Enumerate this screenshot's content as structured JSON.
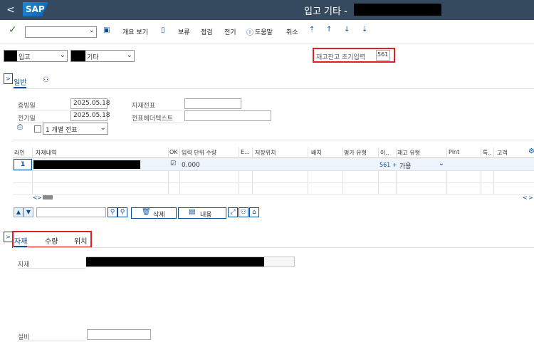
{
  "titlebar": {
    "back": "<",
    "logo": "SAP",
    "title": "입고 기타 -"
  },
  "toolbar": {
    "check": "✓",
    "overview": "개요 보기",
    "hold": "보류",
    "check_btn": "점검",
    "post": "전기",
    "help": "도움말",
    "cancel": "취소"
  },
  "header": {
    "movement_left": "입고",
    "movement_right": "기타",
    "stock_init_label": "재고잔고 초기입력",
    "stock_init_value": "561"
  },
  "tabs_top": {
    "general": "일반"
  },
  "general": {
    "doc_date_label": "증빙일",
    "doc_date": "2025.05.18",
    "post_date_label": "전기일",
    "post_date": "2025.05.18",
    "mat_doc_label": "자재전표",
    "header_text_label": "전표헤더텍스트",
    "slip_option": "1 개별 전표"
  },
  "table": {
    "headers": [
      "라인",
      "자재내역",
      "OK",
      "입력 단위 수량",
      "E...",
      "저장위치",
      "배치",
      "평가 유형",
      "이..",
      "재고 유형",
      "Plnt",
      "특..",
      "고객"
    ],
    "row": {
      "line": "1",
      "ok": "☑",
      "qty": "0.000",
      "movement": "561 +",
      "stock_type": "가용"
    },
    "nav_left": "<",
    "nav_right": ">",
    "nav_left_end": "<",
    "nav_right_end": ">"
  },
  "table_toolbar": {
    "delete": "삭제",
    "content": "내용"
  },
  "tabs_bottom": {
    "material": "자재",
    "quantity": "수량",
    "location": "위치"
  },
  "detail": {
    "material_label": "자재",
    "equipment_label": "설비"
  }
}
